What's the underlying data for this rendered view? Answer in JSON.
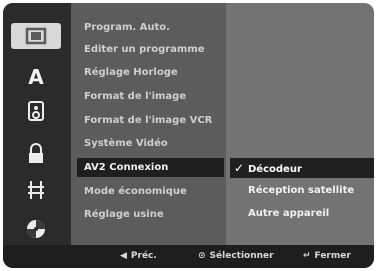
{
  "sidebar": {
    "categories": [
      {
        "icon": "film-icon"
      },
      {
        "icon": "letter-a-icon",
        "label": "A"
      },
      {
        "icon": "speaker-icon"
      },
      {
        "icon": "lock-icon"
      },
      {
        "icon": "h-frame-icon"
      },
      {
        "icon": "disc-icon"
      }
    ]
  },
  "menu": {
    "items": [
      {
        "label": "Program. Auto."
      },
      {
        "label": "Editer un programme"
      },
      {
        "label": "Réglage Horloge"
      },
      {
        "label": "Format de l'image"
      },
      {
        "label": "Format de l'image VCR"
      },
      {
        "label": "Système Vidéo"
      },
      {
        "label": "AV2 Connexion"
      },
      {
        "label": "Mode économique"
      },
      {
        "label": "Réglage usine"
      }
    ],
    "selected_index": 6
  },
  "options": {
    "items": [
      {
        "label": "Décodeur",
        "checked": "✓"
      },
      {
        "label": "Réception satellite",
        "checked": ""
      },
      {
        "label": "Autre appareil",
        "checked": ""
      }
    ],
    "selected_index": 0
  },
  "footer": {
    "prev_label": "Préc.",
    "select_label": "Sélectionner",
    "close_label": "Fermer"
  }
}
